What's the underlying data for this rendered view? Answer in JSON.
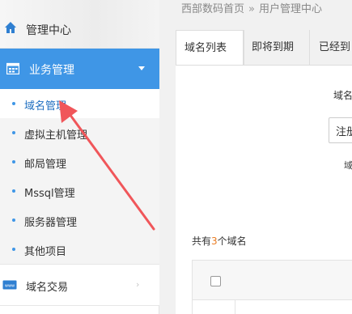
{
  "sidebar": {
    "top_label": "管理中心",
    "active_section": "业务管理",
    "sub_items": [
      "域名管理",
      "虚拟主机管理",
      "邮局管理",
      "Mssql管理",
      "服务器管理",
      "其他项目"
    ],
    "trade_label": "域名交易",
    "trade_arrow": "›"
  },
  "breadcrumb": {
    "home": "西部数码首页",
    "sep": "»",
    "current": "用户管理中心"
  },
  "tabs": [
    "域名列表",
    "即将到期",
    "已经到"
  ],
  "panel": {
    "label1": "域名",
    "input_value": "注册",
    "label2": "域",
    "count_prefix": "共有",
    "count_value": "3",
    "count_suffix": "个域名"
  },
  "colors": {
    "accent": "#3f96e6",
    "annotation_arrow": "#f0565a",
    "count_highlight": "#e97b21"
  }
}
